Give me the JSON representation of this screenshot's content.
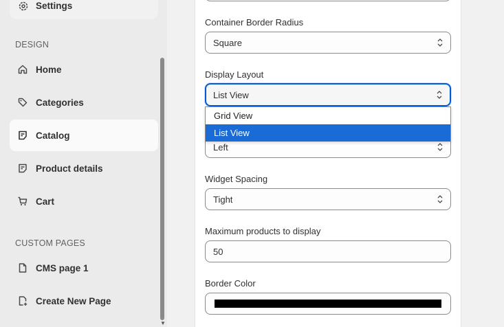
{
  "sidebar": {
    "settings_label": "Settings",
    "design_title": "DESIGN",
    "custom_pages_title": "CUSTOM PAGES",
    "items": [
      {
        "label": "Home",
        "icon": "home-icon"
      },
      {
        "label": "Categories",
        "icon": "tag-icon"
      },
      {
        "label": "Catalog",
        "icon": "note-icon",
        "active": true
      },
      {
        "label": "Product details",
        "icon": "note-icon"
      },
      {
        "label": "Cart",
        "icon": "cart-icon"
      }
    ],
    "pages": [
      {
        "label": "CMS page 1",
        "icon": "page-icon"
      },
      {
        "label": "Create New Page",
        "icon": "page-add-icon"
      }
    ]
  },
  "form": {
    "border_radius": {
      "label": "Container Border Radius",
      "value": "Square"
    },
    "display_layout": {
      "label": "Display Layout",
      "value": "List View",
      "options": [
        "Grid View",
        "List View"
      ],
      "selected_option": "List View"
    },
    "alignment": {
      "value": "Left"
    },
    "widget_spacing": {
      "label": "Widget Spacing",
      "value": "Tight"
    },
    "max_products": {
      "label": "Maximum products to display",
      "value": "50"
    },
    "border_color": {
      "label": "Border Color",
      "value": "#000000"
    }
  }
}
